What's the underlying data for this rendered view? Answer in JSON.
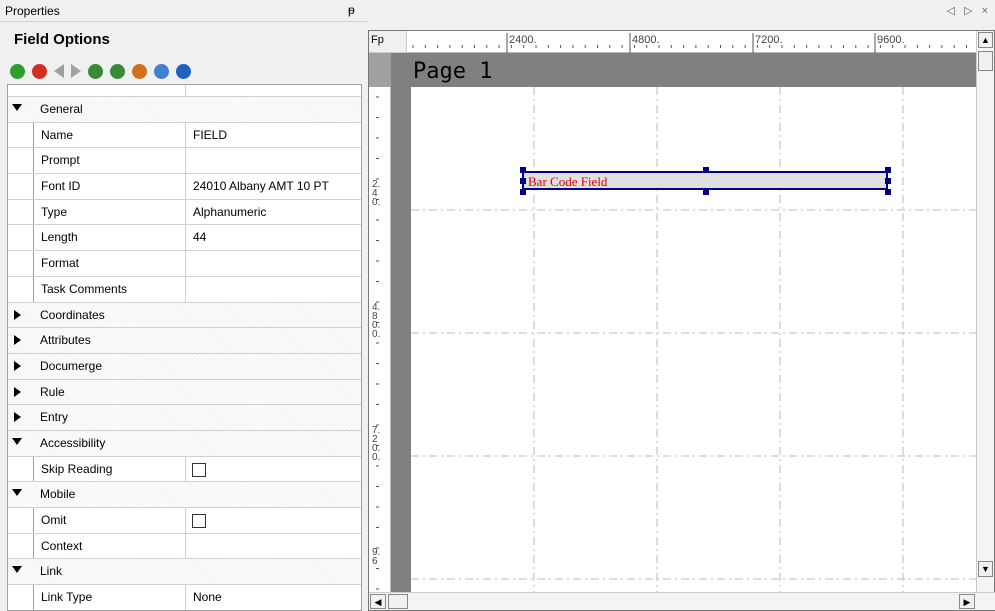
{
  "properties": {
    "title": "Properties",
    "pin_icon": "pin-icon",
    "panel_title": "Field Options",
    "toolbar": [
      {
        "name": "add-icon",
        "color": "#2e9e2e"
      },
      {
        "name": "delete-icon",
        "color": "#d03020"
      },
      {
        "name": "prev-icon",
        "color": "#a0a0a0"
      },
      {
        "name": "next-icon",
        "color": "#a0a0a0"
      },
      {
        "name": "import-icon",
        "color": "#3a8a3a"
      },
      {
        "name": "export-icon",
        "color": "#3a8a3a"
      },
      {
        "name": "user-icon",
        "color": "#d07020"
      },
      {
        "name": "info-icon",
        "color": "#4080d0"
      },
      {
        "name": "help-icon",
        "color": "#2060c0"
      }
    ],
    "rows": [
      {
        "type": "cat",
        "open": true,
        "label": "General"
      },
      {
        "type": "child",
        "label": "Name",
        "value": "FIELD"
      },
      {
        "type": "child",
        "label": "Prompt",
        "value": ""
      },
      {
        "type": "child",
        "label": "Font ID",
        "value": "24010 Albany AMT 10 PT"
      },
      {
        "type": "child",
        "label": "Type",
        "value": "Alphanumeric"
      },
      {
        "type": "child",
        "label": "Length",
        "value": "44"
      },
      {
        "type": "child",
        "label": "Format",
        "value": ""
      },
      {
        "type": "child",
        "label": "Task Comments",
        "value": ""
      },
      {
        "type": "cat",
        "open": false,
        "label": "Coordinates"
      },
      {
        "type": "cat",
        "open": false,
        "label": "Attributes"
      },
      {
        "type": "cat",
        "open": false,
        "label": "Documerge"
      },
      {
        "type": "cat",
        "open": false,
        "label": "Rule"
      },
      {
        "type": "cat",
        "open": false,
        "label": "Entry"
      },
      {
        "type": "cat",
        "open": true,
        "label": "Accessibility"
      },
      {
        "type": "child",
        "label": "Skip Reading",
        "checkbox": true
      },
      {
        "type": "cat",
        "open": true,
        "label": "Mobile"
      },
      {
        "type": "child",
        "label": "Omit",
        "checkbox": true
      },
      {
        "type": "child",
        "label": "Context",
        "value": ""
      },
      {
        "type": "cat",
        "open": true,
        "label": "Link"
      },
      {
        "type": "child",
        "label": "Link Type",
        "value": "None"
      }
    ]
  },
  "designer": {
    "corner_label": "Fp",
    "ruler_top_labels": [
      "2400.",
      "4800.",
      "7200.",
      "9600."
    ],
    "ruler_left_labels": [
      "2.\n4\n0.",
      "4.\n8\n0.\n0.",
      "7.\n2\n0.\n0.",
      "9.\n6"
    ],
    "page_title": "Page 1",
    "field_label": "Bar Code Field",
    "tab_nav": "◁ ▷ ×"
  }
}
